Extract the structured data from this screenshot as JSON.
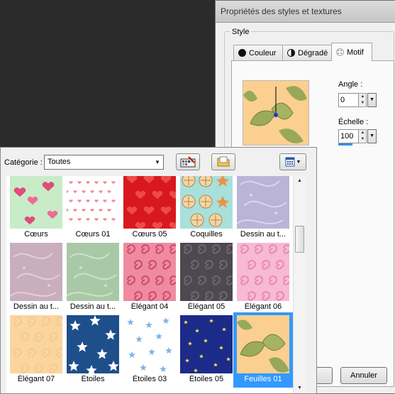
{
  "dialog": {
    "title": "Propriétés des styles et textures",
    "group_label": "Style",
    "tabs": [
      {
        "label": "Couleur",
        "icon": "solid-circle-icon"
      },
      {
        "label": "Dégradé",
        "icon": "gradient-circle-icon"
      },
      {
        "label": "Motif",
        "icon": "pattern-icon"
      }
    ],
    "angle_label": "Angle :",
    "angle_value": "0",
    "scale_label": "Échelle :",
    "scale_value": "100",
    "cancel_label": "Annuler"
  },
  "popup": {
    "category_label": "Catégorie :",
    "category_value": "Toutes",
    "toolbar_icons": [
      "palette-settings-icon",
      "folder-icon",
      "view-options-icon"
    ],
    "tiles": [
      {
        "label": "Cœurs",
        "pattern": "hearts-green"
      },
      {
        "label": "Cœurs 01",
        "pattern": "hearts-small"
      },
      {
        "label": "Cœurs 05",
        "pattern": "hearts-red"
      },
      {
        "label": "Coquilles",
        "pattern": "shells"
      },
      {
        "label": "Dessin au t...",
        "pattern": "swirl-lavender"
      },
      {
        "label": "Dessin au t...",
        "pattern": "swirl-mauve"
      },
      {
        "label": "Dessin au t...",
        "pattern": "swirl-sage"
      },
      {
        "label": "Élégant 04",
        "pattern": "curls-pink"
      },
      {
        "label": "Élégant 05",
        "pattern": "curls-dark"
      },
      {
        "label": "Élégant 06",
        "pattern": "curls-lightpink"
      },
      {
        "label": "Élégant 07",
        "pattern": "curls-peach"
      },
      {
        "label": "Étoiles",
        "pattern": "stars-blue"
      },
      {
        "label": "Étoiles 03",
        "pattern": "stars-white"
      },
      {
        "label": "Étoiles 05",
        "pattern": "stars-navy"
      },
      {
        "label": "Feuilles 01",
        "pattern": "leaves",
        "selected": true
      }
    ]
  }
}
